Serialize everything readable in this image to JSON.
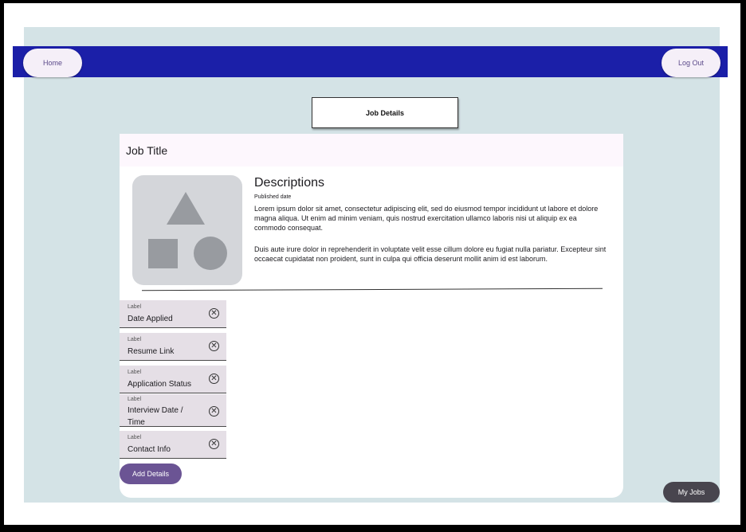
{
  "nav": {
    "home_label": "Home",
    "logout_label": "Log Out",
    "bar_color": "#1b1fa8"
  },
  "header_box": {
    "label": "Job Details"
  },
  "card": {
    "title": "Job Title",
    "image_placeholder": "shapes-placeholder-icon",
    "descriptions_heading": "Descriptions",
    "published_date": "Published date",
    "paragraph1": "Lorem ipsum dolor sit amet, consectetur adipiscing elit, sed do eiusmod tempor incididunt ut labore et dolore magna aliqua. Ut enim ad minim veniam, quis nostrud exercitation ullamco laboris nisi ut aliquip ex ea commodo consequat.",
    "paragraph2": "Duis aute irure dolor in reprehenderit in voluptate velit esse cillum dolore eu fugiat nulla pariatur. Excepteur sint occaecat cupidatat non proident, sunt in culpa qui officia deserunt mollit anim id est laborum."
  },
  "fields": [
    {
      "label": "Label",
      "value": "Date Applied"
    },
    {
      "label": "Label",
      "value": "Resume Link"
    },
    {
      "label": "Label",
      "value": "Application Status"
    },
    {
      "label": "Label",
      "value": "Interview Date / Time"
    },
    {
      "label": "Label",
      "value": "Contact Info"
    }
  ],
  "actions": {
    "add_details_label": "Add Details",
    "my_jobs_label": "My Jobs",
    "accent_color": "#6b5494"
  }
}
